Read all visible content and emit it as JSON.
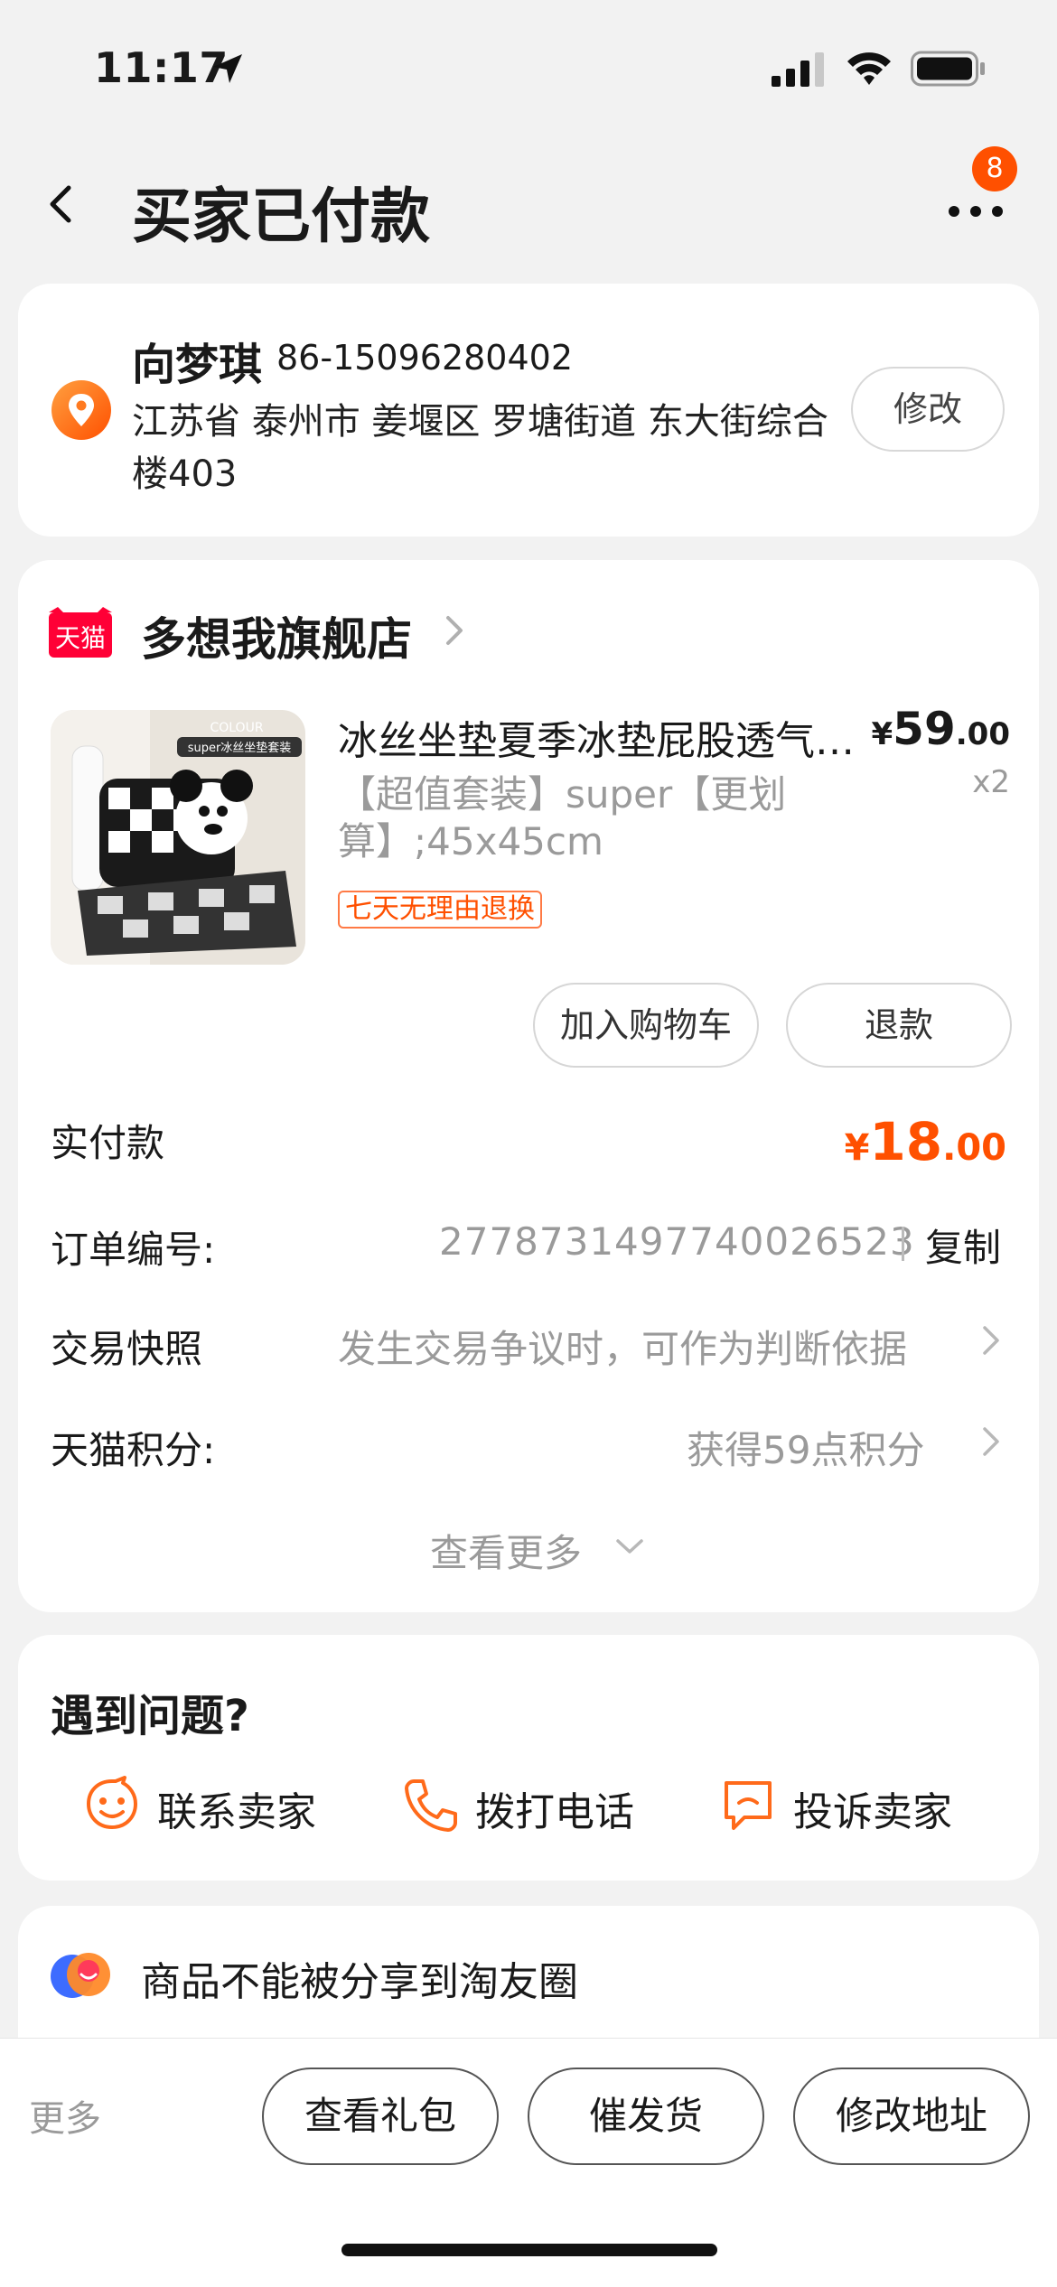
{
  "status_bar": {
    "time": "11:17"
  },
  "nav": {
    "title": "买家已付款",
    "more_badge": "8"
  },
  "address": {
    "name": "向梦琪",
    "phone": "86-15096280402",
    "detail": "江苏省 泰州市 姜堰区 罗塘街道 东大街综合楼403",
    "modify_label": "修改"
  },
  "shop": {
    "logo_text": "天猫",
    "name": "多想我旗舰店"
  },
  "product": {
    "title": "冰丝坐垫夏季冰垫屁股透气办公室久坐",
    "spec": "【超值套装】super【更划算】;45x45cm",
    "return_tag": "七天无理由退换",
    "price_symbol": "¥",
    "price_int": "59",
    "price_dec": ".00",
    "quantity": "x2",
    "image_label_top": "COLOUR",
    "image_label_banner": "super冰丝坐垫套装"
  },
  "actions": {
    "add_cart": "加入购物车",
    "refund": "退款"
  },
  "payment": {
    "label": "实付款",
    "symbol": "¥",
    "int": "18",
    "dec": ".00"
  },
  "order_info": {
    "order_no_label": "订单编号:",
    "order_no": "2778731497740026523",
    "copy_label": "复制",
    "snapshot_label": "交易快照",
    "snapshot_value": "发生交易争议时，可作为判断依据",
    "points_label": "天猫积分:",
    "points_value": "获得59点积分",
    "see_more": "查看更多"
  },
  "help": {
    "title": "遇到问题?",
    "items": [
      {
        "label": "联系卖家",
        "icon": "chat-face-icon"
      },
      {
        "label": "拨打电话",
        "icon": "phone-icon"
      },
      {
        "label": "投诉卖家",
        "icon": "complaint-icon"
      }
    ]
  },
  "share": {
    "text": "商品不能被分享到淘友圈"
  },
  "bottom": {
    "more": "更多",
    "buttons": [
      "查看礼包",
      "催发货",
      "修改地址"
    ]
  },
  "colors": {
    "accent": "#ff5000",
    "background": "#f2f2f2"
  }
}
